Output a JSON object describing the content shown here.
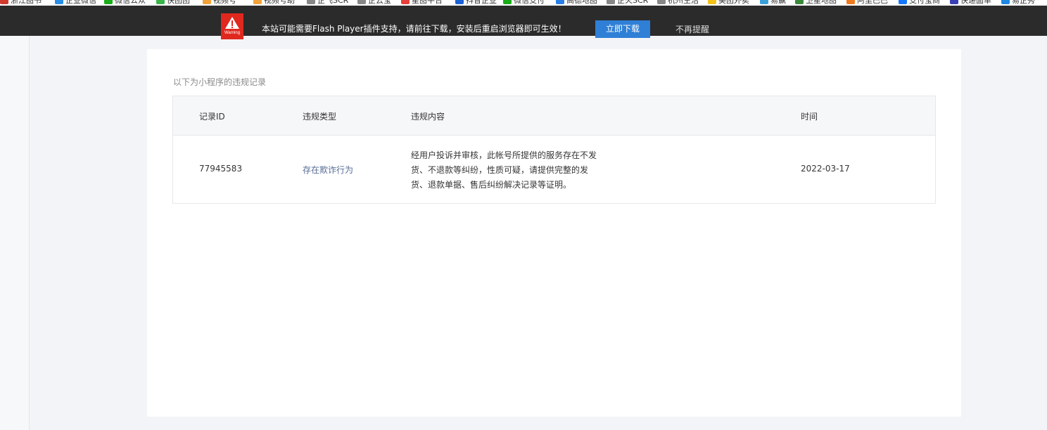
{
  "bookmarks": {
    "items": [
      {
        "label": "浙江图书",
        "color": "#d13b2e"
      },
      {
        "label": "企业微信",
        "color": "#2a8ee6"
      },
      {
        "label": "微信公众",
        "color": "#1aad19"
      },
      {
        "label": "快团团",
        "color": "#3ab54a"
      },
      {
        "label": "视频号",
        "color": "#f2a23a"
      },
      {
        "label": "视频号助",
        "color": "#f2a23a"
      },
      {
        "label": "企飞SCR",
        "color": "#888888"
      },
      {
        "label": "企云宝",
        "color": "#888888"
      },
      {
        "label": "星图平台",
        "color": "#e5403a"
      },
      {
        "label": "抖音企业",
        "color": "#1c62d6"
      },
      {
        "label": "微信支付",
        "color": "#1aad19"
      },
      {
        "label": "高德地图",
        "color": "#2a7fe6"
      },
      {
        "label": "企火SCR",
        "color": "#888888"
      },
      {
        "label": "杭州生活",
        "color": "#888888"
      },
      {
        "label": "美团外卖",
        "color": "#f5c218"
      },
      {
        "label": "易赢",
        "color": "#3aa0d8"
      },
      {
        "label": "卫星地图",
        "color": "#3a8a3a"
      },
      {
        "label": "阿里巴巴",
        "color": "#f07a1f"
      },
      {
        "label": "支付宝商",
        "color": "#1677ff"
      },
      {
        "label": "快递面单",
        "color": "#3b3fb5"
      },
      {
        "label": "易企秀",
        "color": "#1e88e5"
      }
    ]
  },
  "flash_notice": {
    "warning_label": "Warning",
    "message": "本站可能需要Flash Player插件支持，请前往下载，安装后重启浏览器即可生效！",
    "download_button": "立即下载",
    "dismiss_label": "不再提醒"
  },
  "records": {
    "section_title": "以下为小程序的违规记录",
    "columns": {
      "id": "记录ID",
      "type": "违规类型",
      "content": "违规内容",
      "time": "时间"
    },
    "rows": [
      {
        "id": "77945583",
        "type": "存在欺诈行为",
        "content": "经用户投诉并审核，此帐号所提供的服务存在不发货、不退款等纠纷，性质可疑，请提供完整的发货、退款单据、售后纠纷解决记录等证明。",
        "time": "2022-03-17"
      }
    ]
  }
}
